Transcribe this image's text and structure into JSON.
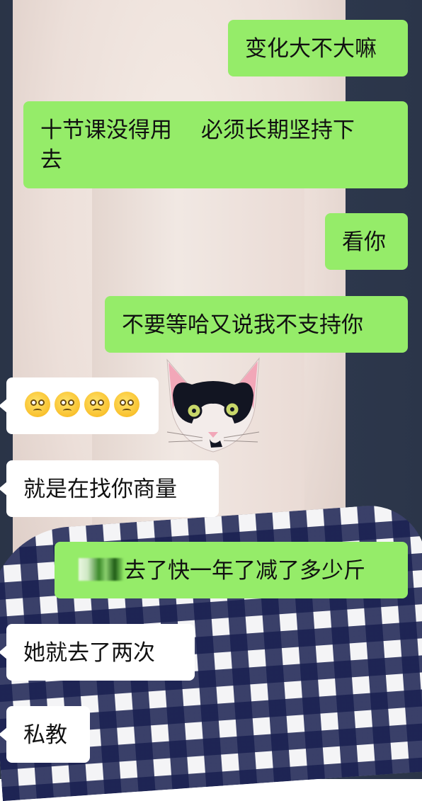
{
  "messages": [
    {
      "id": "m1",
      "side": "out",
      "text": "变化大不大嘛"
    },
    {
      "id": "m2",
      "side": "out",
      "line1": "十节课没得用　 必须长期坚持下",
      "line2": "去"
    },
    {
      "id": "m3",
      "side": "out",
      "text": "看你"
    },
    {
      "id": "m4",
      "side": "out",
      "text": "不要等哈又说我不支持你"
    },
    {
      "id": "m5",
      "side": "in",
      "emoji_name": "pleading-face-icon",
      "emoji_count": 4
    },
    {
      "id": "m6",
      "side": "in",
      "text": "就是在找你商量"
    },
    {
      "id": "m7",
      "side": "out",
      "text": "去了快一年了减了多少斤",
      "redacted_prefix": true
    },
    {
      "id": "m8",
      "side": "in",
      "text": "她就去了两次"
    },
    {
      "id": "m9",
      "side": "in",
      "text": "私教"
    }
  ],
  "colors": {
    "outgoing_bubble": "#95ec69",
    "incoming_bubble": "#ffffff",
    "text": "#111111"
  }
}
